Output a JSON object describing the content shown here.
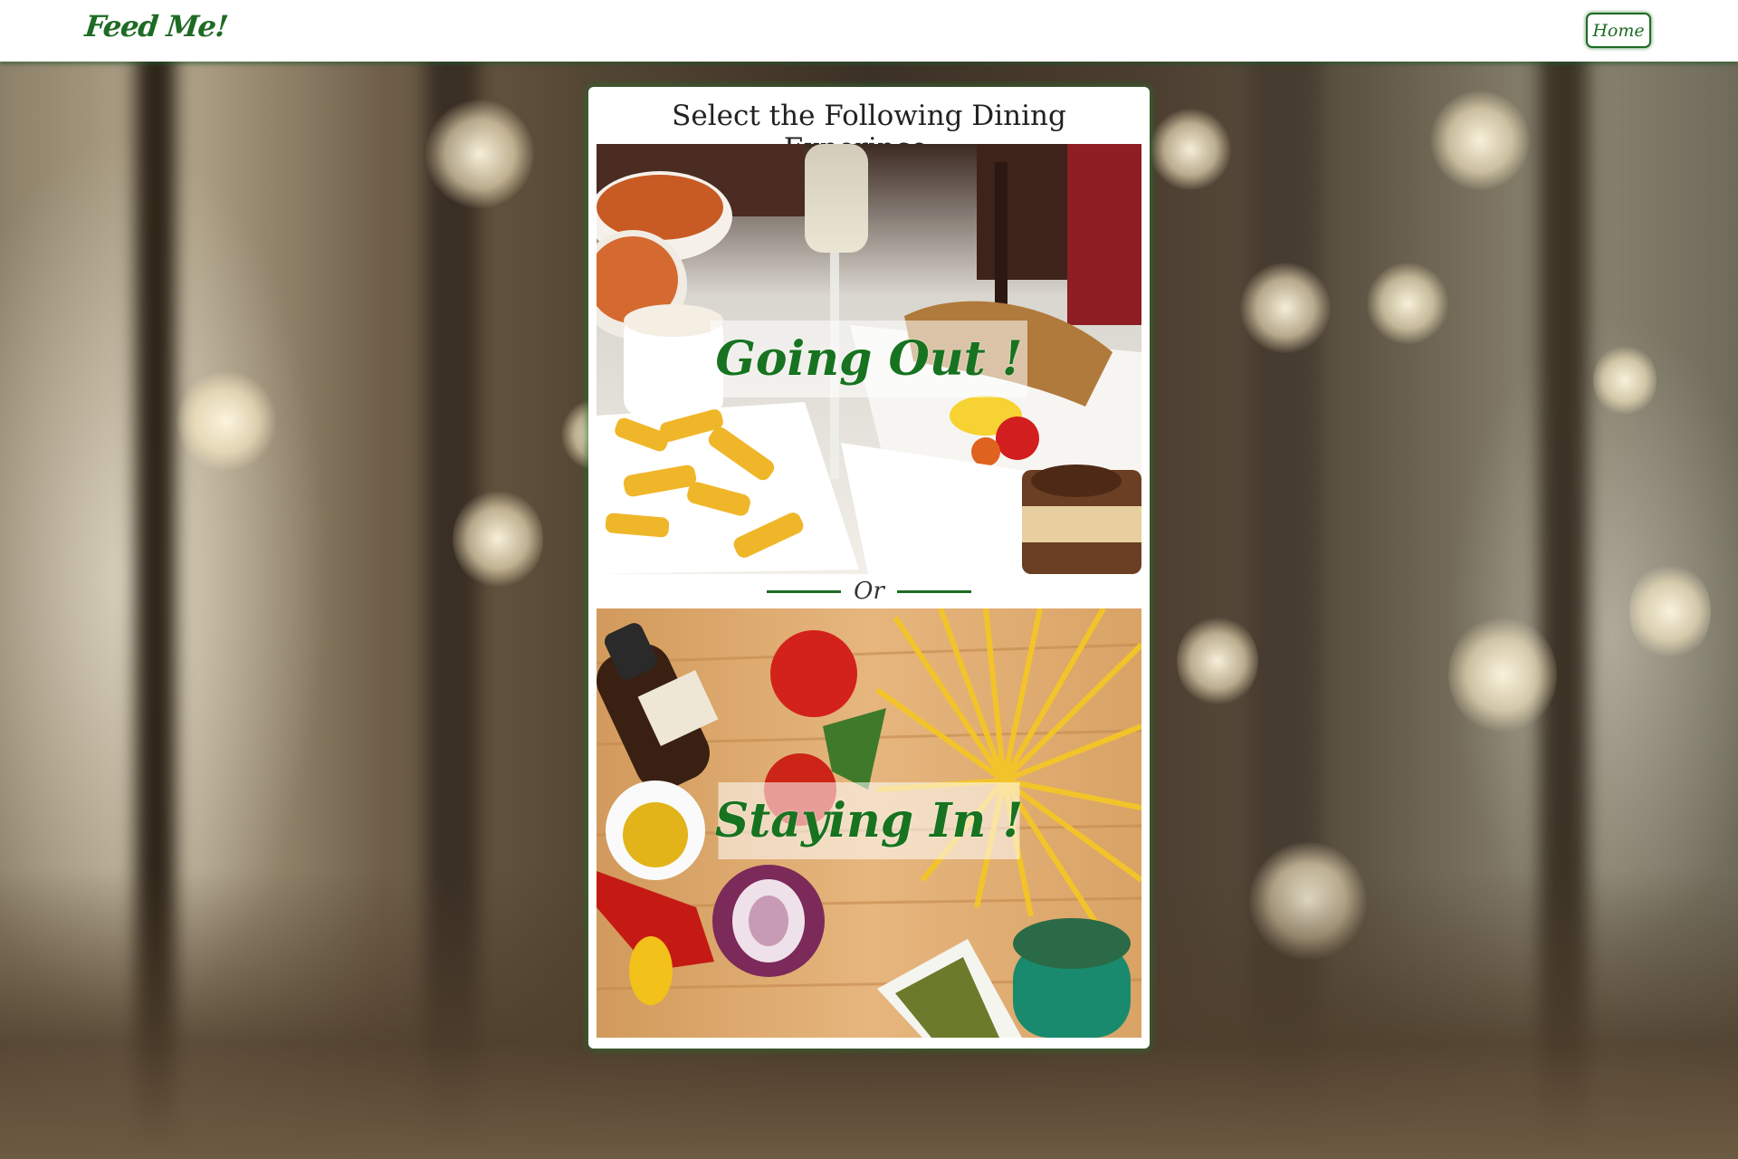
{
  "nav": {
    "brand": "Feed Me!",
    "home_label": "Home"
  },
  "card": {
    "title": "Select the Following Dining Experince...",
    "option_going_out": "Going Out !",
    "divider_text": "Or",
    "option_staying_in": "Staying In !"
  },
  "colors": {
    "brand_green": "#1e6b24",
    "label_green": "#17731f",
    "card_bg": "#ffffff"
  }
}
